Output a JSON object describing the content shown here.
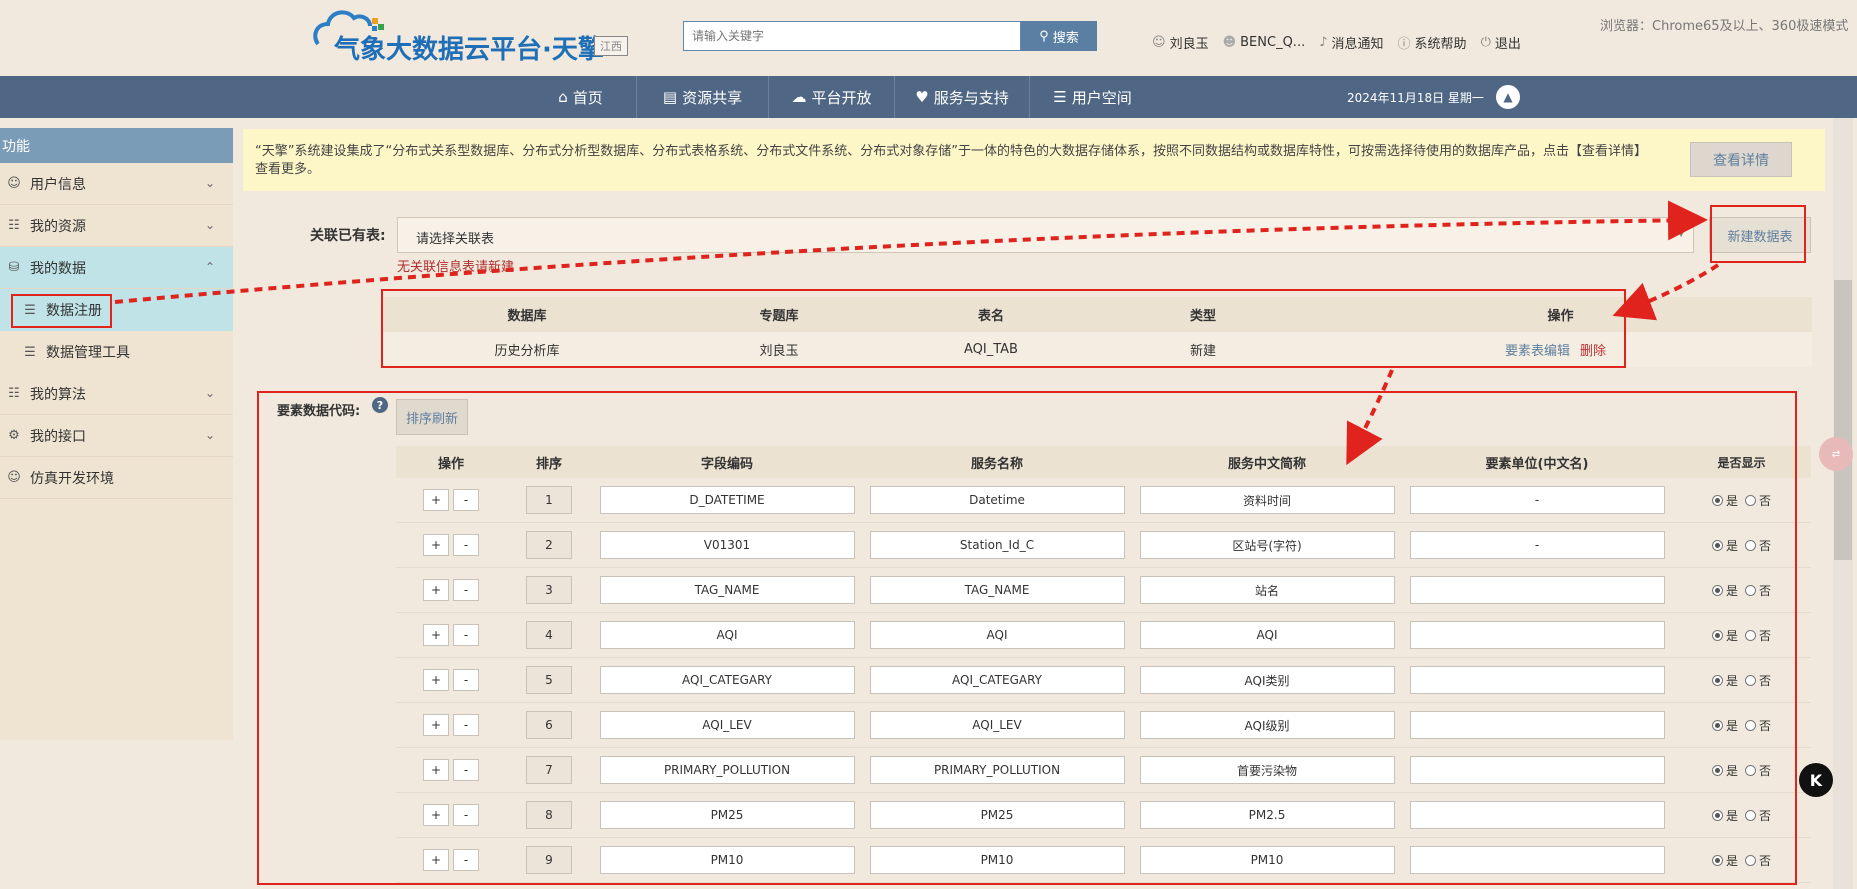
{
  "header": {
    "logo_text": "气象大数据云平台·天擎",
    "region": "江西",
    "search_placeholder": "请输入关键字",
    "search_button": "搜索",
    "user_name": "刘良玉",
    "account": "BENC_Q...",
    "messages": "消息通知",
    "help": "系统帮助",
    "logout": "退出",
    "browser_tip": "浏览器：Chrome65及以上、360极速模式"
  },
  "nav": {
    "items": [
      "首页",
      "资源共享",
      "平台开放",
      "服务与支持",
      "用户空间"
    ],
    "date": "2024年11月18日  星期一"
  },
  "sidebar": {
    "title": "功能",
    "items": [
      {
        "label": "用户信息"
      },
      {
        "label": "我的资源"
      },
      {
        "label": "我的数据"
      },
      {
        "label": "数据注册"
      },
      {
        "label": "数据管理工具"
      },
      {
        "label": "我的算法"
      },
      {
        "label": "我的接口"
      },
      {
        "label": "仿真开发环境"
      }
    ]
  },
  "notice": {
    "text": "“天擎”系统建设集成了“分布式关系型数据库、分布式分析型数据库、分布式表格系统、分布式文件系统、分布式对象存储”于一体的特色的大数据存储体系，按照不同数据结构或数据库特性，可按需选择待使用的数据库产品，点击【查看详情】查看更多。",
    "button": "查看详情"
  },
  "relation": {
    "label": "关联已有表:",
    "select_value": "请选择关联表",
    "new_button": "新建数据表",
    "error": "无关联信息表请新建"
  },
  "table1": {
    "headers": [
      "数据库",
      "专题库",
      "表名",
      "类型",
      "操作"
    ],
    "row": {
      "db": "历史分析库",
      "topic": "刘良玉",
      "name": "AQI_TAB",
      "type": "新建",
      "edit": "要素表编辑",
      "delete": "删除"
    }
  },
  "elements": {
    "label": "要素数据代码:",
    "help": "?",
    "sort_button": "排序刷新",
    "headers": [
      "操作",
      "排序",
      "字段编码",
      "服务名称",
      "服务中文简称",
      "要素单位(中文名)",
      "是否显示"
    ],
    "plus": "+",
    "minus": "-",
    "yes": "是",
    "no": "否",
    "rows": [
      {
        "sort": "1",
        "code": "D_DATETIME",
        "svc": "Datetime",
        "cn": "资料时间",
        "unit": "-"
      },
      {
        "sort": "2",
        "code": "V01301",
        "svc": "Station_Id_C",
        "cn": "区站号(字符)",
        "unit": "-"
      },
      {
        "sort": "3",
        "code": "TAG_NAME",
        "svc": "TAG_NAME",
        "cn": "站名",
        "unit": ""
      },
      {
        "sort": "4",
        "code": "AQI",
        "svc": "AQI",
        "cn": "AQI",
        "unit": ""
      },
      {
        "sort": "5",
        "code": "AQI_CATEGARY",
        "svc": "AQI_CATEGARY",
        "cn": "AQI类别",
        "unit": ""
      },
      {
        "sort": "6",
        "code": "AQI_LEV",
        "svc": "AQI_LEV",
        "cn": "AQI级别",
        "unit": ""
      },
      {
        "sort": "7",
        "code": "PRIMARY_POLLUTION",
        "svc": "PRIMARY_POLLUTION",
        "cn": "首要污染物",
        "unit": ""
      },
      {
        "sort": "8",
        "code": "PM25",
        "svc": "PM25",
        "cn": "PM2.5",
        "unit": ""
      },
      {
        "sort": "9",
        "code": "PM10",
        "svc": "PM10",
        "cn": "PM10",
        "unit": ""
      }
    ]
  },
  "colors": {
    "nav_bg": "#4f6784",
    "sidebar_head": "#7b9cb6",
    "active_bg": "#bfe3e6",
    "annotation": "#e0231c"
  }
}
